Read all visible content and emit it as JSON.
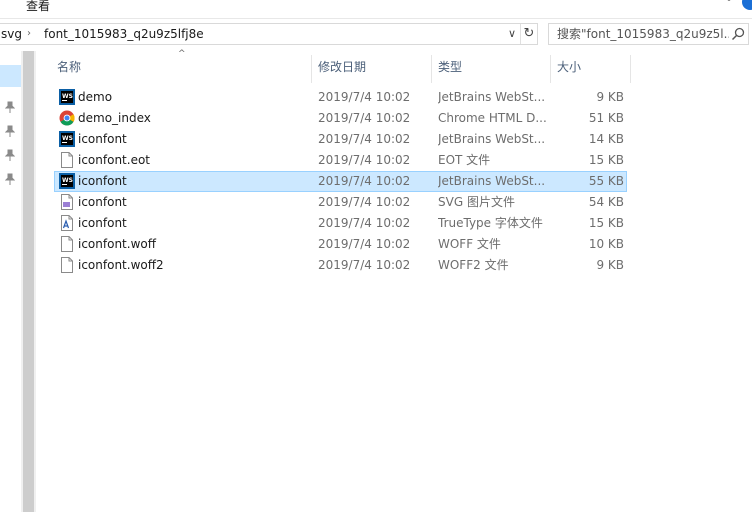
{
  "ribbon": {
    "tab_view": "查看",
    "expand_glyph": "﹀"
  },
  "address": {
    "crumbs": [
      "svg",
      "font_1015983_q2u9z5lfj8e"
    ],
    "separator": "›",
    "dropdown_glyph": "∨",
    "refresh_glyph": "↻"
  },
  "search": {
    "placeholder": "搜索\"font_1015983_q2u9z5l..."
  },
  "nav": {
    "pin_glyph": "📌"
  },
  "columns": {
    "name": "名称",
    "date": "修改日期",
    "type": "类型",
    "size": "大小",
    "sort_glyph": "^"
  },
  "files": [
    {
      "icon": "webstorm-icon",
      "name": "demo",
      "date": "2019/7/4 10:02",
      "type": "JetBrains WebSt...",
      "size": "9 KB"
    },
    {
      "icon": "chrome-icon",
      "name": "demo_index",
      "date": "2019/7/4 10:02",
      "type": "Chrome HTML D...",
      "size": "51 KB"
    },
    {
      "icon": "webstorm-icon",
      "name": "iconfont",
      "date": "2019/7/4 10:02",
      "type": "JetBrains WebSt...",
      "size": "14 KB"
    },
    {
      "icon": "file-icon",
      "name": "iconfont.eot",
      "date": "2019/7/4 10:02",
      "type": "EOT 文件",
      "size": "15 KB"
    },
    {
      "icon": "webstorm-icon",
      "name": "iconfont",
      "date": "2019/7/4 10:02",
      "type": "JetBrains WebSt...",
      "size": "55 KB",
      "selected": true
    },
    {
      "icon": "svg-file-icon",
      "name": "iconfont",
      "date": "2019/7/4 10:02",
      "type": "SVG 图片文件",
      "size": "54 KB"
    },
    {
      "icon": "font-file-icon",
      "name": "iconfont",
      "date": "2019/7/4 10:02",
      "type": "TrueType 字体文件",
      "size": "15 KB"
    },
    {
      "icon": "file-icon",
      "name": "iconfont.woff",
      "date": "2019/7/4 10:02",
      "type": "WOFF 文件",
      "size": "10 KB"
    },
    {
      "icon": "file-icon",
      "name": "iconfont.woff2",
      "date": "2019/7/4 10:02",
      "type": "WOFF2 文件",
      "size": "9 KB"
    }
  ],
  "colors": {
    "selection": "#cce8ff",
    "selection_border": "#99d1ff",
    "header_text": "#4c607a",
    "meta_text": "#6d6d6d"
  }
}
